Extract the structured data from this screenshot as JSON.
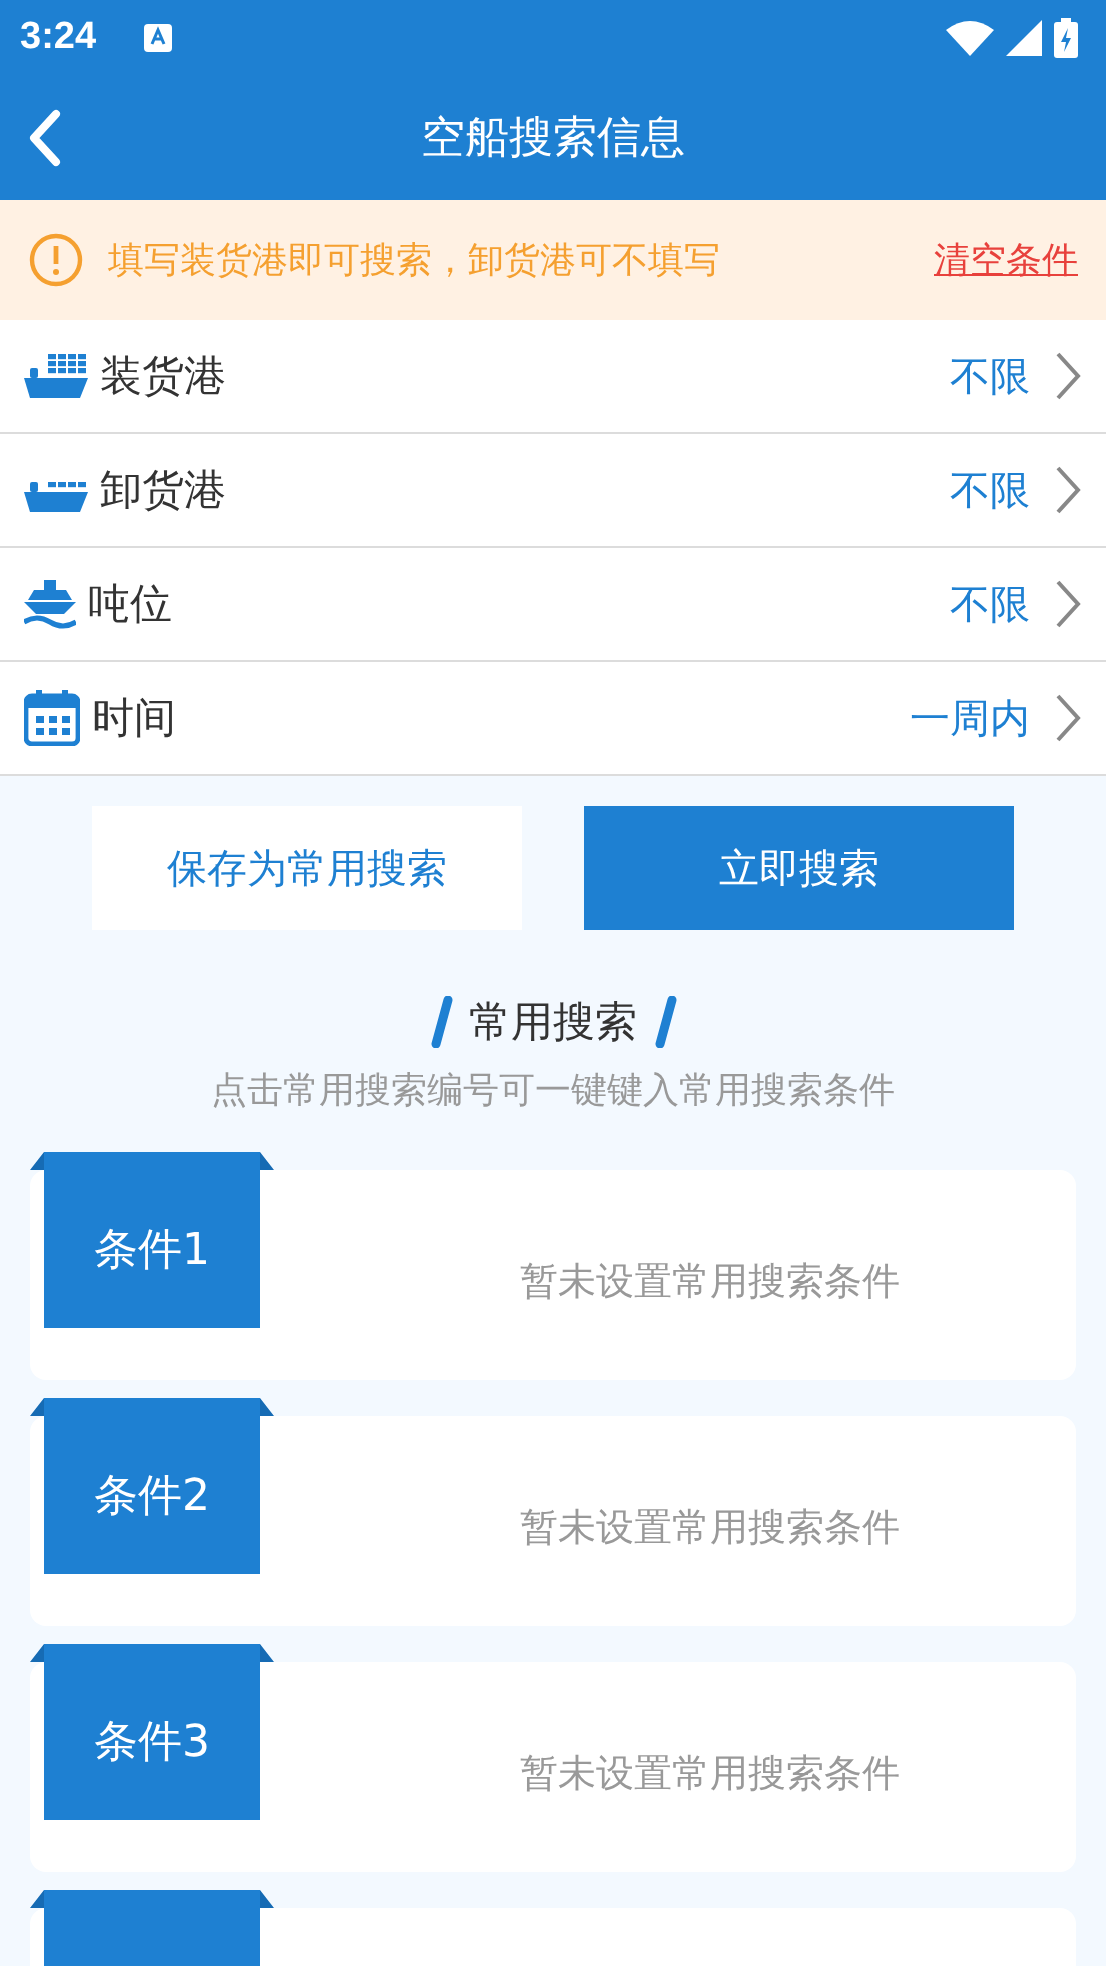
{
  "status_bar": {
    "time": "3:24"
  },
  "app_bar": {
    "title": "空船搜索信息"
  },
  "notice": {
    "text": "填写装货港即可搜索，卸货港可不填写",
    "action": "清空条件"
  },
  "filters": [
    {
      "kind": "loading",
      "label": "装货港",
      "value": "不限"
    },
    {
      "kind": "unloading",
      "label": "卸货港",
      "value": "不限"
    },
    {
      "kind": "tonnage",
      "label": "吨位",
      "value": "不限"
    },
    {
      "kind": "time",
      "label": "时间",
      "value": "一周内"
    }
  ],
  "buttons": {
    "save": "保存为常用搜索",
    "search": "立即搜索"
  },
  "saved": {
    "title": "常用搜索",
    "hint": "点击常用搜索编号可一键键入常用搜索条件",
    "slots": [
      {
        "kind": "card",
        "label": "条件1",
        "text": "暂未设置常用搜索条件"
      },
      {
        "kind": "card",
        "label": "条件2",
        "text": "暂未设置常用搜索条件"
      },
      {
        "kind": "card",
        "label": "条件3",
        "text": "暂未设置常用搜索条件"
      },
      {
        "kind": "card"
      }
    ]
  }
}
